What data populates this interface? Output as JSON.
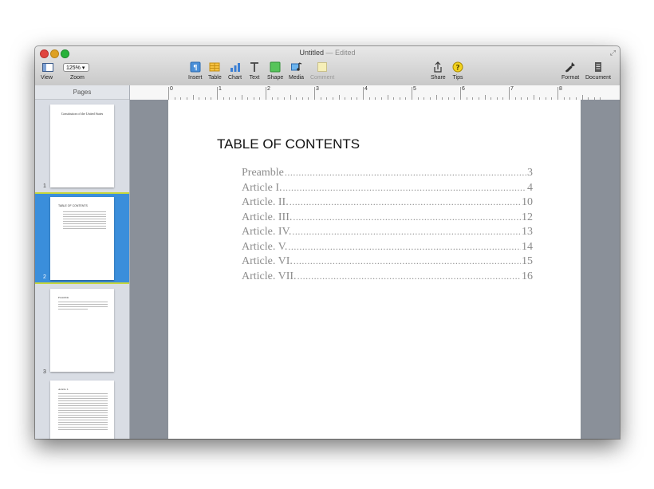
{
  "window": {
    "title": "Untitled",
    "status": "— Edited"
  },
  "toolbar": {
    "view_label": "View",
    "zoom_value": "125% ▾",
    "zoom_label": "Zoom",
    "items": [
      {
        "label": "Insert",
        "icon": "insert-icon"
      },
      {
        "label": "Table",
        "icon": "table-icon"
      },
      {
        "label": "Chart",
        "icon": "chart-icon"
      },
      {
        "label": "Text",
        "icon": "text-icon"
      },
      {
        "label": "Shape",
        "icon": "shape-icon"
      },
      {
        "label": "Media",
        "icon": "media-icon"
      },
      {
        "label": "Comment",
        "icon": "comment-icon"
      },
      {
        "label": "Share",
        "icon": "share-icon"
      },
      {
        "label": "Tips",
        "icon": "tips-icon"
      },
      {
        "label": "Format",
        "icon": "format-icon"
      },
      {
        "label": "Document",
        "icon": "document-icon"
      }
    ]
  },
  "sidebar": {
    "header": "Pages",
    "pages": [
      {
        "number": "1",
        "title": "Constitution of the United States"
      },
      {
        "number": "2",
        "title": "TABLE OF CONTENTS"
      },
      {
        "number": "3",
        "title": "Preamble"
      },
      {
        "number": "",
        "title": "Article I."
      }
    ]
  },
  "ruler": {
    "marks": [
      "0",
      "1",
      "2",
      "3",
      "4",
      "5",
      "6",
      "7",
      "8"
    ]
  },
  "document": {
    "heading": "TABLE OF CONTENTS",
    "toc": [
      {
        "label": "Preamble",
        "page": "3"
      },
      {
        "label": "Article I.",
        "page": "4"
      },
      {
        "label": "Article. II. ",
        "page": "10"
      },
      {
        "label": "Article. III. ",
        "page": "12"
      },
      {
        "label": "Article. IV. ",
        "page": "13"
      },
      {
        "label": "Article. V.",
        "page": "14"
      },
      {
        "label": "Article. VI.",
        "page": "15"
      },
      {
        "label": "Article. VII.",
        "page": "16"
      }
    ]
  },
  "colors": {
    "selection": "#3a8edb",
    "selection_border": "#c6d63c",
    "canvas": "#8a9099"
  }
}
